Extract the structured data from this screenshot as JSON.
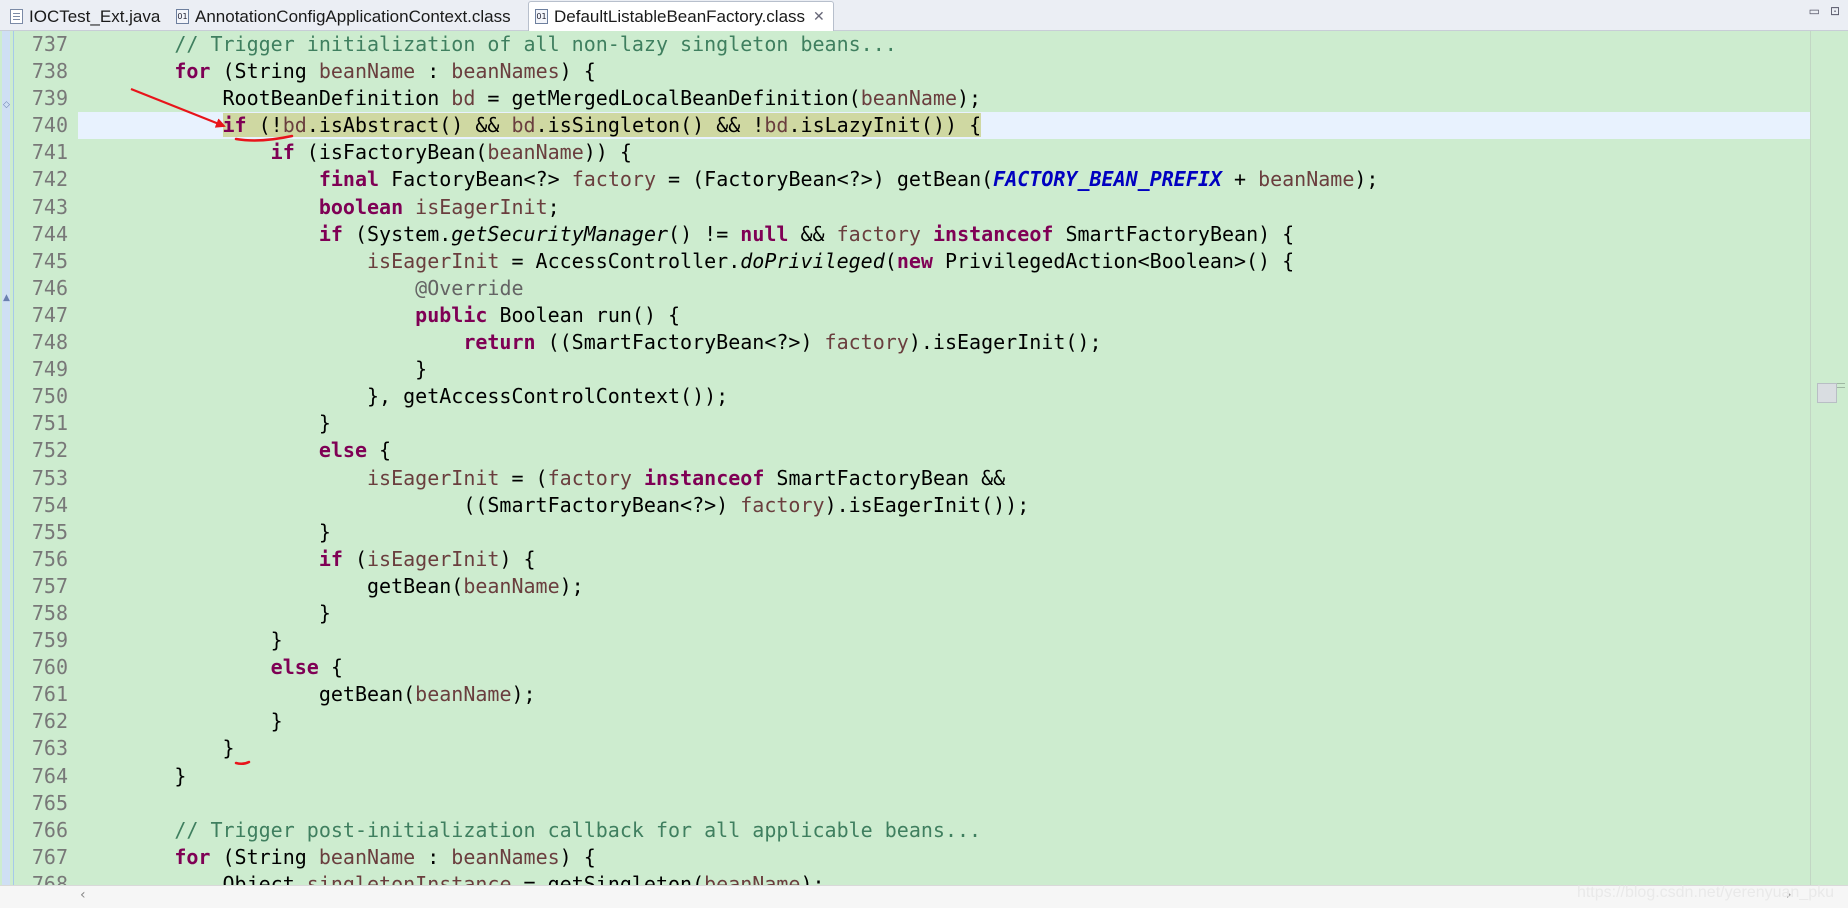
{
  "tabs": [
    {
      "label": "IOCTest_Ext.java",
      "icon": "java-file-icon",
      "active": false
    },
    {
      "label": "AnnotationConfigApplicationContext.class",
      "icon": "class-file-icon",
      "active": false
    },
    {
      "label": "DefaultListableBeanFactory.class",
      "icon": "class-file-icon",
      "active": true
    }
  ],
  "window_controls": {
    "minimize": "▭",
    "maximize": "⊡"
  },
  "editor": {
    "current_line": 740,
    "lines": [
      {
        "num": "737",
        "tokens": [
          [
            "pl",
            "        "
          ],
          [
            "cm",
            "// Trigger initialization of all non-lazy singleton beans..."
          ]
        ]
      },
      {
        "num": "738",
        "tokens": [
          [
            "pl",
            "        "
          ],
          [
            "kw",
            "for"
          ],
          [
            "pl",
            " (String "
          ],
          [
            "var",
            "beanName"
          ],
          [
            "pl",
            " : "
          ],
          [
            "var",
            "beanNames"
          ],
          [
            "pl",
            ") {"
          ]
        ]
      },
      {
        "num": "739",
        "tokens": [
          [
            "pl",
            "            RootBeanDefinition "
          ],
          [
            "var",
            "bd"
          ],
          [
            "pl",
            " = getMergedLocalBeanDefinition("
          ],
          [
            "var",
            "beanName"
          ],
          [
            "pl",
            ");"
          ]
        ]
      },
      {
        "num": "740",
        "tokens": [
          [
            "pl",
            "            "
          ],
          [
            "hl_kw",
            "if"
          ],
          [
            "hl",
            " (!"
          ],
          [
            "hl_var",
            "bd"
          ],
          [
            "hl",
            ".isAbstract() && "
          ],
          [
            "hl_var",
            "bd"
          ],
          [
            "hl",
            ".isSingleton() && !"
          ],
          [
            "hl_var",
            "bd"
          ],
          [
            "hl",
            ".isLazyInit()) {"
          ]
        ]
      },
      {
        "num": "741",
        "tokens": [
          [
            "pl",
            "                "
          ],
          [
            "kw",
            "if"
          ],
          [
            "pl",
            " (isFactoryBean("
          ],
          [
            "var",
            "beanName"
          ],
          [
            "pl",
            ")) {"
          ]
        ]
      },
      {
        "num": "742",
        "tokens": [
          [
            "pl",
            "                    "
          ],
          [
            "kw",
            "final"
          ],
          [
            "pl",
            " FactoryBean<?> "
          ],
          [
            "var",
            "factory"
          ],
          [
            "pl",
            " = (FactoryBean<?>) getBean("
          ],
          [
            "cn",
            "FACTORY_BEAN_PREFIX"
          ],
          [
            "pl",
            " + "
          ],
          [
            "var",
            "beanName"
          ],
          [
            "pl",
            ");"
          ]
        ]
      },
      {
        "num": "743",
        "tokens": [
          [
            "pl",
            "                    "
          ],
          [
            "kw",
            "boolean"
          ],
          [
            "pl",
            " "
          ],
          [
            "var",
            "isEagerInit"
          ],
          [
            "pl",
            ";"
          ]
        ]
      },
      {
        "num": "744",
        "tokens": [
          [
            "pl",
            "                    "
          ],
          [
            "kw",
            "if"
          ],
          [
            "pl",
            " (System."
          ],
          [
            "it",
            "getSecurityManager"
          ],
          [
            "pl",
            "() != "
          ],
          [
            "kw",
            "null"
          ],
          [
            "pl",
            " && "
          ],
          [
            "var",
            "factory"
          ],
          [
            "pl",
            " "
          ],
          [
            "kw",
            "instanceof"
          ],
          [
            "pl",
            " SmartFactoryBean) {"
          ]
        ]
      },
      {
        "num": "745",
        "tokens": [
          [
            "pl",
            "                        "
          ],
          [
            "var",
            "isEagerInit"
          ],
          [
            "pl",
            " = AccessController."
          ],
          [
            "it",
            "doPrivileged"
          ],
          [
            "pl",
            "("
          ],
          [
            "kw",
            "new"
          ],
          [
            "pl",
            " PrivilegedAction<Boolean>() {"
          ]
        ]
      },
      {
        "num": "746",
        "tokens": [
          [
            "pl",
            "                            "
          ],
          [
            "an",
            "@Override"
          ]
        ]
      },
      {
        "num": "747",
        "tokens": [
          [
            "pl",
            "                            "
          ],
          [
            "kw",
            "public"
          ],
          [
            "pl",
            " Boolean run() {"
          ]
        ]
      },
      {
        "num": "748",
        "tokens": [
          [
            "pl",
            "                                "
          ],
          [
            "kw",
            "return"
          ],
          [
            "pl",
            " ((SmartFactoryBean<?>) "
          ],
          [
            "var",
            "factory"
          ],
          [
            "pl",
            ").isEagerInit();"
          ]
        ]
      },
      {
        "num": "749",
        "tokens": [
          [
            "pl",
            "                            }"
          ]
        ]
      },
      {
        "num": "750",
        "tokens": [
          [
            "pl",
            "                        }, getAccessControlContext());"
          ]
        ]
      },
      {
        "num": "751",
        "tokens": [
          [
            "pl",
            "                    }"
          ]
        ]
      },
      {
        "num": "752",
        "tokens": [
          [
            "pl",
            "                    "
          ],
          [
            "kw",
            "else"
          ],
          [
            "pl",
            " {"
          ]
        ]
      },
      {
        "num": "753",
        "tokens": [
          [
            "pl",
            "                        "
          ],
          [
            "var",
            "isEagerInit"
          ],
          [
            "pl",
            " = ("
          ],
          [
            "var",
            "factory"
          ],
          [
            "pl",
            " "
          ],
          [
            "kw",
            "instanceof"
          ],
          [
            "pl",
            " SmartFactoryBean &&"
          ]
        ]
      },
      {
        "num": "754",
        "tokens": [
          [
            "pl",
            "                                ((SmartFactoryBean<?>) "
          ],
          [
            "var",
            "factory"
          ],
          [
            "pl",
            ").isEagerInit());"
          ]
        ]
      },
      {
        "num": "755",
        "tokens": [
          [
            "pl",
            "                    }"
          ]
        ]
      },
      {
        "num": "756",
        "tokens": [
          [
            "pl",
            "                    "
          ],
          [
            "kw",
            "if"
          ],
          [
            "pl",
            " ("
          ],
          [
            "var",
            "isEagerInit"
          ],
          [
            "pl",
            ") {"
          ]
        ]
      },
      {
        "num": "757",
        "tokens": [
          [
            "pl",
            "                        getBean("
          ],
          [
            "var",
            "beanName"
          ],
          [
            "pl",
            ");"
          ]
        ]
      },
      {
        "num": "758",
        "tokens": [
          [
            "pl",
            "                    }"
          ]
        ]
      },
      {
        "num": "759",
        "tokens": [
          [
            "pl",
            "                }"
          ]
        ]
      },
      {
        "num": "760",
        "tokens": [
          [
            "pl",
            "                "
          ],
          [
            "kw",
            "else"
          ],
          [
            "pl",
            " {"
          ]
        ]
      },
      {
        "num": "761",
        "tokens": [
          [
            "pl",
            "                    getBean("
          ],
          [
            "var",
            "beanName"
          ],
          [
            "pl",
            ");"
          ]
        ]
      },
      {
        "num": "762",
        "tokens": [
          [
            "pl",
            "                }"
          ]
        ]
      },
      {
        "num": "763",
        "tokens": [
          [
            "pl",
            "            }"
          ]
        ]
      },
      {
        "num": "764",
        "tokens": [
          [
            "pl",
            "        }"
          ]
        ]
      },
      {
        "num": "765",
        "tokens": [
          [
            "pl",
            ""
          ]
        ]
      },
      {
        "num": "766",
        "tokens": [
          [
            "pl",
            "        "
          ],
          [
            "cm",
            "// Trigger post-initialization callback for all applicable beans..."
          ]
        ]
      },
      {
        "num": "767",
        "tokens": [
          [
            "pl",
            "        "
          ],
          [
            "kw",
            "for"
          ],
          [
            "pl",
            " (String "
          ],
          [
            "var",
            "beanName"
          ],
          [
            "pl",
            " : "
          ],
          [
            "var",
            "beanNames"
          ],
          [
            "pl",
            ") {"
          ]
        ]
      },
      {
        "num": "768",
        "tokens": [
          [
            "pl",
            "            Object "
          ],
          [
            "var",
            "singletonInstance"
          ],
          [
            "pl",
            " = getSingleton("
          ],
          [
            "var",
            "beanName"
          ],
          [
            "pl",
            ");"
          ]
        ]
      }
    ]
  },
  "watermark": "https://blog.csdn.net/yerenyuan_pku",
  "colors": {
    "editor_bg": "#cdeccf",
    "keyword": "#7f0055",
    "comment": "#3f7f5f",
    "local_var": "#6a3e3e",
    "constant": "#0000c0",
    "annotation_red": "#e8141b"
  }
}
